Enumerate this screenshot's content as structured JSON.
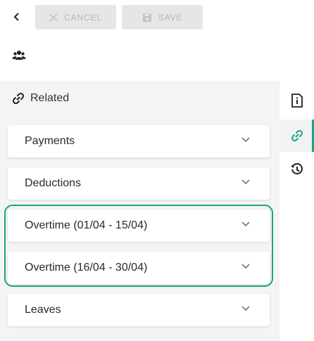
{
  "toolbar": {
    "back_icon": "chevron-left-icon",
    "cancel_label": "CANCEL",
    "save_label": "SAVE"
  },
  "entity_icon": "users-icon",
  "related": {
    "header_label": "Related",
    "items": [
      {
        "label": "Payments"
      },
      {
        "label": "Deductions"
      },
      {
        "label": "Overtime (01/04 - 15/04)"
      },
      {
        "label": "Overtime (16/04 - 30/04)"
      },
      {
        "label": "Leaves"
      }
    ]
  },
  "side_rail": {
    "items": [
      {
        "icon": "info-icon",
        "active": false
      },
      {
        "icon": "link-icon",
        "active": true
      },
      {
        "icon": "history-icon",
        "active": false
      }
    ]
  },
  "colors": {
    "accent": "#1ba388",
    "disabled_button_bg": "#e6e6e6",
    "disabled_button_text": "#b5b5b5",
    "panel_bg": "#f4f4f4"
  }
}
